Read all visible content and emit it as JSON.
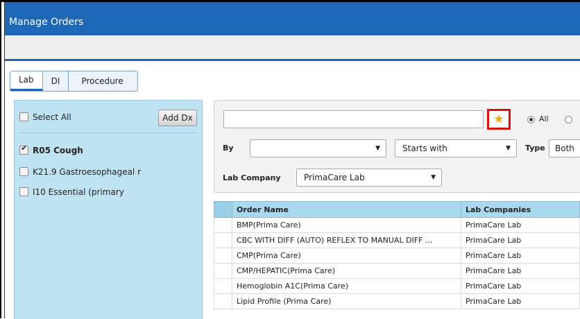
{
  "window": {
    "title": "Manage Orders"
  },
  "tabs": [
    {
      "label": "Lab",
      "active": true
    },
    {
      "label": "DI",
      "active": false
    },
    {
      "label": "Procedure",
      "active": false
    }
  ],
  "diagnosis_panel": {
    "select_all_label": "Select All",
    "add_dx_label": "Add Dx",
    "items": [
      {
        "label": "R05 Cough",
        "checked": true,
        "bold": true
      },
      {
        "label": "K21.9 Gastroesophageal r",
        "checked": false,
        "bold": false
      },
      {
        "label": "I10 Essential (primary",
        "checked": false,
        "bold": false
      }
    ]
  },
  "search": {
    "query": "",
    "favorite_icon": "star-icon",
    "scope_options": [
      {
        "label": "All",
        "selected": true
      },
      {
        "label": "",
        "selected": false
      }
    ],
    "by_label": "By",
    "by_value": "",
    "match_value": "Starts with",
    "type_label": "Type",
    "type_value": "Both",
    "lab_company_label": "Lab Company",
    "lab_company_value": "PrimaCare Lab"
  },
  "orders_table": {
    "columns": [
      "",
      "Order Name",
      "Lab Companies"
    ],
    "rows": [
      {
        "order_name": "BMP(Prima Care)",
        "lab_company": "PrimaCare Lab"
      },
      {
        "order_name": "CBC WITH DIFF (AUTO) REFLEX TO MANUAL DIFF ...",
        "lab_company": "PrimaCare Lab"
      },
      {
        "order_name": "CMP(Prima Care)",
        "lab_company": "PrimaCare Lab"
      },
      {
        "order_name": "CMP/HEPATIC(Prima Care)",
        "lab_company": "PrimaCare Lab"
      },
      {
        "order_name": "Hemoglobin A1C(Prima Care)",
        "lab_company": "PrimaCare Lab"
      },
      {
        "order_name": "Lipid Profile (Prima Care)",
        "lab_company": "PrimaCare Lab"
      }
    ]
  },
  "colors": {
    "title_bar": "#1e66b6",
    "dx_panel": "#bfe3f3",
    "table_header": "#aad8ee",
    "highlight_border": "#e01010",
    "star": "#f0a80e"
  }
}
